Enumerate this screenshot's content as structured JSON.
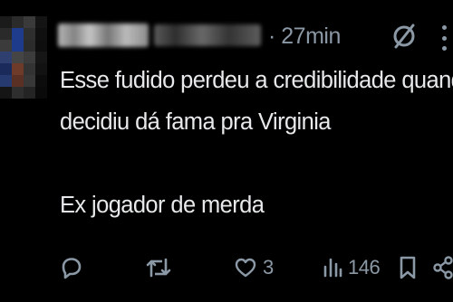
{
  "post": {
    "time": "· 27min",
    "lines": [
      "Esse fudido perdeu a credibilidade quando",
      "decidiu dá fama pra Virginia",
      "Ex jogador de merda"
    ]
  },
  "actions": {
    "reply": {
      "icon": "reply-icon"
    },
    "repost": {
      "icon": "repost-icon"
    },
    "like": {
      "icon": "heart-icon",
      "count": "3"
    },
    "views": {
      "icon": "views-chart-icon",
      "count": "146"
    },
    "bookmark": {
      "icon": "bookmark-icon"
    },
    "share": {
      "icon": "share-icon"
    }
  },
  "colors": {
    "background": "#000000",
    "text": "#e7e9ea",
    "muted": "#8b98a5"
  }
}
